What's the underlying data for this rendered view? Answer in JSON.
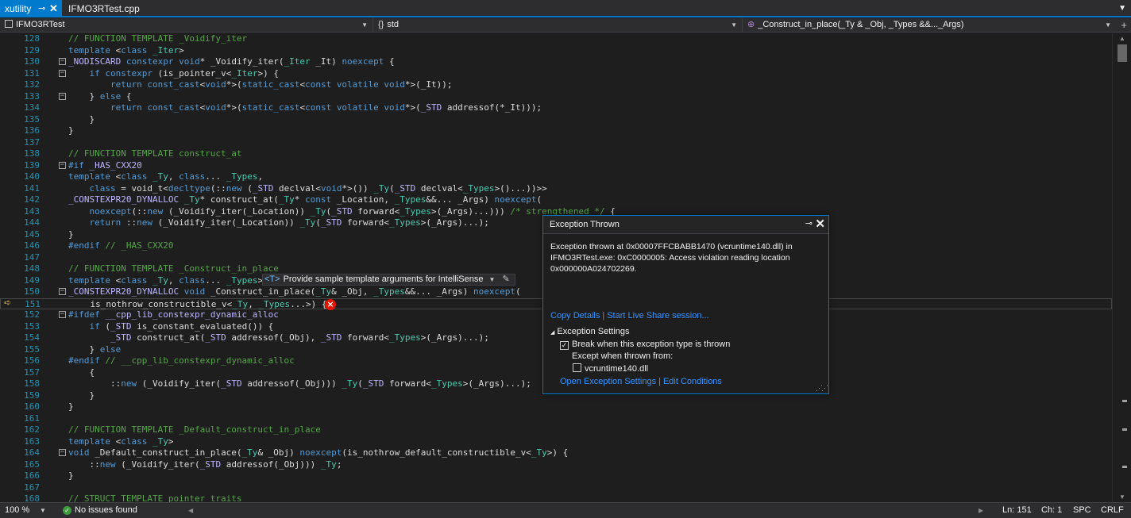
{
  "tabs": [
    {
      "label": "xutility",
      "active": true
    },
    {
      "label": "IFMO3RTest.cpp",
      "active": false
    }
  ],
  "nav": {
    "project": "IFMO3RTest",
    "namespace": "std",
    "member": "_Construct_in_place(_Ty & _Obj, _Types &&..._Args)"
  },
  "code_lines": [
    {
      "n": "128",
      "html": "<span class=\"cm\">// FUNCTION TEMPLATE _Voidify_iter</span>"
    },
    {
      "n": "129",
      "html": "<span class=\"kw\">template</span> &lt;<span class=\"kw\">class</span> <span class=\"ty\">_Iter</span>&gt;"
    },
    {
      "n": "130",
      "fold": "−",
      "html": "<span class=\"mac\">_NODISCARD</span> <span class=\"kw\">constexpr</span> <span class=\"kw\">void</span>* _Voidify_iter(<span class=\"ty\">_Iter</span> _It) <span class=\"kw\">noexcept</span> {"
    },
    {
      "n": "131",
      "fold": "−",
      "html": "    <span class=\"kw\">if constexpr</span> (is_pointer_v&lt;<span class=\"ty\">_Iter</span>&gt;) {"
    },
    {
      "n": "132",
      "html": "        <span class=\"kw\">return</span> <span class=\"kw\">const_cast</span>&lt;<span class=\"kw\">void</span>*&gt;(<span class=\"kw\">static_cast</span>&lt;<span class=\"kw\">const volatile void</span>*&gt;(_It));"
    },
    {
      "n": "133",
      "fold": "−",
      "html": "    } <span class=\"kw\">else</span> {"
    },
    {
      "n": "134",
      "html": "        <span class=\"kw\">return</span> <span class=\"kw\">const_cast</span>&lt;<span class=\"kw\">void</span>*&gt;(<span class=\"kw\">static_cast</span>&lt;<span class=\"kw\">const volatile void</span>*&gt;(<span class=\"mac\">_STD</span> addressof(*_It)));"
    },
    {
      "n": "135",
      "html": "    }"
    },
    {
      "n": "136",
      "html": "}"
    },
    {
      "n": "137",
      "html": ""
    },
    {
      "n": "138",
      "html": "<span class=\"cm\">// FUNCTION TEMPLATE construct_at</span>"
    },
    {
      "n": "139",
      "fold": "−",
      "html": "<span class=\"kw\">#if</span> <span class=\"mac\">_HAS_CXX20</span>"
    },
    {
      "n": "140",
      "html": "<span class=\"kw\">template</span> &lt;<span class=\"kw\">class</span> <span class=\"ty\">_Ty</span>, <span class=\"kw\">class</span>... <span class=\"ty\">_Types</span>,"
    },
    {
      "n": "141",
      "html": "    <span class=\"kw\">class</span> = void_t&lt;<span class=\"kw\">decltype</span>(::<span class=\"kw\">new</span> (<span class=\"mac\">_STD</span> declval&lt;<span class=\"kw\">void</span>*&gt;()) <span class=\"ty\">_Ty</span>(<span class=\"mac\">_STD</span> declval&lt;<span class=\"ty\">_Types</span>&gt;()...))&gt;&gt;"
    },
    {
      "n": "142",
      "html": "<span class=\"mac\">_CONSTEXPR20_DYNALLOC</span> <span class=\"ty\">_Ty</span>* construct_at(<span class=\"ty\">_Ty</span>* <span class=\"kw\">const</span> _Location, <span class=\"ty\">_Types</span>&amp;&amp;... _Args) <span class=\"kw\">noexcept</span>("
    },
    {
      "n": "143",
      "html": "    <span class=\"kw\">noexcept</span>(::<span class=\"kw\">new</span> (_Voidify_iter(_Location)) <span class=\"ty\">_Ty</span>(<span class=\"mac\">_STD</span> forward&lt;<span class=\"ty\">_Types</span>&gt;(_Args)...))) <span class=\"cm\">/* strengthened */</span> {"
    },
    {
      "n": "144",
      "html": "    <span class=\"kw\">return</span> ::<span class=\"kw\">new</span> (_Voidify_iter(_Location)) <span class=\"ty\">_Ty</span>(<span class=\"mac\">_STD</span> forward&lt;<span class=\"ty\">_Types</span>&gt;(_Args)...);"
    },
    {
      "n": "145",
      "html": "}"
    },
    {
      "n": "146",
      "html": "<span class=\"kw\">#endif</span> <span class=\"cm\">// _HAS_CXX20</span>"
    },
    {
      "n": "147",
      "html": ""
    },
    {
      "n": "148",
      "html": "<span class=\"cm\">// FUNCTION TEMPLATE _Construct_in_place</span>"
    },
    {
      "n": "149",
      "html": "<span class=\"kw\">template</span> &lt;<span class=\"kw\">class</span> <span class=\"ty\">_Ty</span>, <span class=\"kw\">class</span>... <span class=\"ty\">_Types</span>&gt;"
    },
    {
      "n": "150",
      "fold": "−",
      "html": "<span class=\"mac\">_CONSTEXPR20_DYNALLOC</span> <span class=\"kw\">void</span> _Construct_in_place(<span class=\"ty\">_Ty</span>&amp; _Obj, <span class=\"ty\">_Types</span>&amp;&amp;... _Args) <span class=\"kw\">noexcept</span>("
    },
    {
      "n": "151",
      "current": true,
      "html": "    is_nothrow_constructible_v&lt;<span class=\"ty\">_Ty</span>, <span class=\"ty\">_Types</span>...&gt;) {"
    },
    {
      "n": "152",
      "fold": "−",
      "html": "<span class=\"kw\">#ifdef</span> <span class=\"mac\">__cpp_lib_constexpr_dynamic_alloc</span>"
    },
    {
      "n": "153",
      "html": "    <span class=\"kw\">if</span> (<span class=\"mac\">_STD</span> is_constant_evaluated()) {"
    },
    {
      "n": "154",
      "html": "        <span class=\"mac\">_STD</span> construct_at(<span class=\"mac\">_STD</span> addressof(_Obj), <span class=\"mac\">_STD</span> forward&lt;<span class=\"ty\">_Types</span>&gt;(_Args)...);"
    },
    {
      "n": "155",
      "html": "    } <span class=\"kw\">else</span>"
    },
    {
      "n": "156",
      "html": "<span class=\"kw\">#endif</span> <span class=\"cm\">// __cpp_lib_constexpr_dynamic_alloc</span>"
    },
    {
      "n": "157",
      "html": "    {"
    },
    {
      "n": "158",
      "html": "        ::<span class=\"kw\">new</span> (_Voidify_iter(<span class=\"mac\">_STD</span> addressof(_Obj))) <span class=\"ty\">_Ty</span>(<span class=\"mac\">_STD</span> forward&lt;<span class=\"ty\">_Types</span>&gt;(_Args)...);"
    },
    {
      "n": "159",
      "html": "    }"
    },
    {
      "n": "160",
      "html": "}"
    },
    {
      "n": "161",
      "html": ""
    },
    {
      "n": "162",
      "html": "<span class=\"cm\">// FUNCTION TEMPLATE _Default_construct_in_place</span>"
    },
    {
      "n": "163",
      "html": "<span class=\"kw\">template</span> &lt;<span class=\"kw\">class</span> <span class=\"ty\">_Ty</span>&gt;"
    },
    {
      "n": "164",
      "fold": "−",
      "html": "<span class=\"kw\">void</span> _Default_construct_in_place(<span class=\"ty\">_Ty</span>&amp; _Obj) <span class=\"kw\">noexcept</span>(is_nothrow_default_constructible_v&lt;<span class=\"ty\">_Ty</span>&gt;) {"
    },
    {
      "n": "165",
      "html": "    ::<span class=\"kw\">new</span> (_Voidify_iter(<span class=\"mac\">_STD</span> addressof(_Obj))) <span class=\"ty\">_Ty</span>;"
    },
    {
      "n": "166",
      "html": "}"
    },
    {
      "n": "167",
      "html": ""
    },
    {
      "n": "168",
      "html": "<span class=\"cm\">// STRUCT TEMPLATE pointer_traits</span>"
    }
  ],
  "intellisense": {
    "tag": "<T>",
    "label": "Provide sample template arguments for IntelliSense"
  },
  "exception_popup": {
    "title": "Exception Thrown",
    "message_line1": "Exception thrown at 0x00007FFCBABB1470 (vcruntime140.dll) in",
    "message_line2": "IFMO3RTest.exe: 0xC0000005: Access violation reading location",
    "message_line3": "0x000000A024702269.",
    "copy_details": "Copy Details",
    "live_share": "Start Live Share session...",
    "settings_header": "Exception Settings",
    "break_label": "Break when this exception type is thrown",
    "break_checked": true,
    "except_label": "Except when thrown from:",
    "module_label": "vcruntime140.dll",
    "module_checked": false,
    "open_settings": "Open Exception Settings",
    "edit_conditions": "Edit Conditions"
  },
  "status": {
    "zoom": "100 %",
    "issues": "No issues found",
    "line": "Ln: 151",
    "char": "Ch: 1",
    "whitespace": "SPC",
    "line_ending": "CRLF"
  },
  "colors": {
    "accent": "#007acc",
    "background": "#1e1e1e",
    "chrome": "#2d2d30",
    "keyword": "#569cd6",
    "comment": "#57a64a",
    "type": "#4ec9b0",
    "macro": "#beb7ff",
    "line_number": "#2b91af",
    "error": "#e51400",
    "link": "#3794ff"
  }
}
